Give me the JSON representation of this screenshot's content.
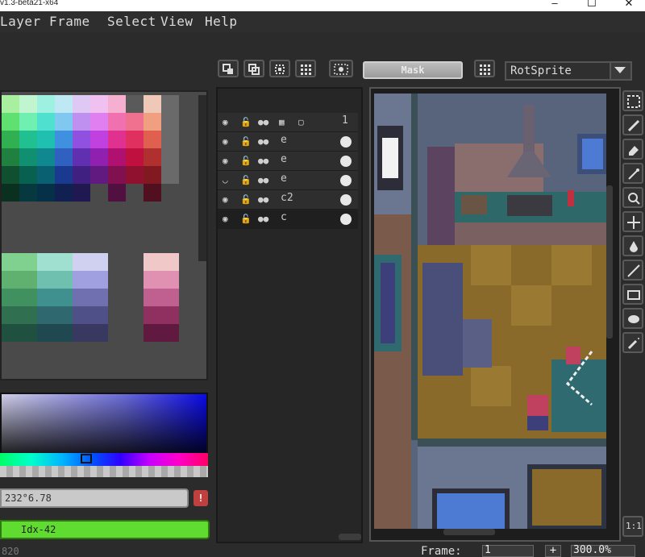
{
  "window": {
    "title": "v1.3-beta21-x64",
    "minimize_glyph": "–",
    "maximize_glyph": "☐",
    "close_glyph": "✕"
  },
  "menu": [
    {
      "label": "Layer",
      "key": "L"
    },
    {
      "label": "Frame",
      "key": "r"
    },
    {
      "label": "Select",
      "key": "S"
    },
    {
      "label": "View",
      "key": "V"
    },
    {
      "label": "Help",
      "key": "H"
    }
  ],
  "toolbar": {
    "mask_label": "Mask",
    "rotation_algorithm": "RotSprite"
  },
  "color": {
    "hsv_value": "232°6.78",
    "warning_glyph": "!",
    "index_value": "Idx-42",
    "accent_green": "#5fdc2f"
  },
  "layers": [
    {
      "name": "",
      "cel": "1",
      "header": true
    },
    {
      "name": "e",
      "visible": true
    },
    {
      "name": "e",
      "visible": true
    },
    {
      "name": "e",
      "visible": false
    },
    {
      "name": "c2",
      "visible": true
    },
    {
      "name": "c",
      "visible": true,
      "active": true
    }
  ],
  "status": {
    "left_text": "820",
    "frame_label": "Frame:",
    "frame_value": "1",
    "plus_label": "+",
    "zoom_value": "300.0%"
  },
  "tools": {
    "one_to_one_label": "1:1"
  }
}
